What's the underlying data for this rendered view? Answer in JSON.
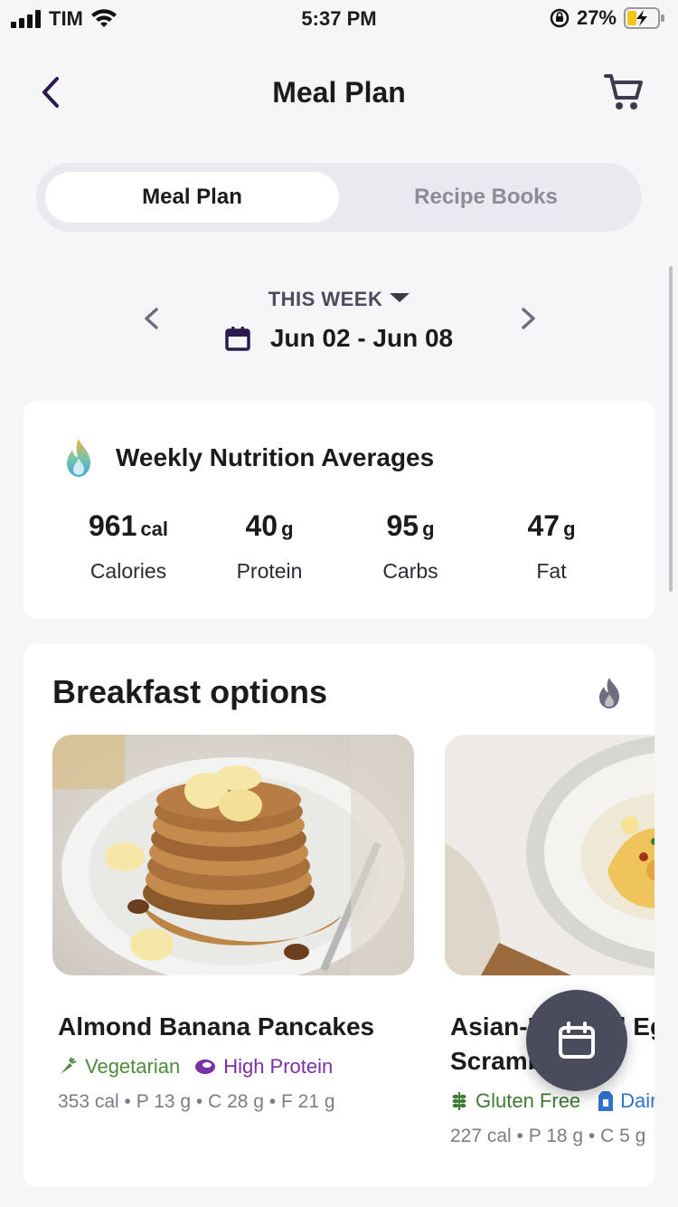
{
  "status_bar": {
    "carrier": "TIM",
    "time": "5:37 PM",
    "battery": "27%"
  },
  "nav": {
    "title": "Meal Plan"
  },
  "segmented": {
    "active": "Meal Plan",
    "inactive": "Recipe Books"
  },
  "week": {
    "label": "THIS WEEK",
    "range": "Jun 02 - Jun 08"
  },
  "nutrition": {
    "title": "Weekly Nutrition Averages",
    "stats": [
      {
        "value": "961",
        "unit": "cal",
        "label": "Calories"
      },
      {
        "value": "40",
        "unit": "g",
        "label": "Protein"
      },
      {
        "value": "95",
        "unit": "g",
        "label": "Carbs"
      },
      {
        "value": "47",
        "unit": "g",
        "label": "Fat"
      }
    ]
  },
  "breakfast": {
    "title": "Breakfast options",
    "recipes": [
      {
        "name": "Almond Banana Pancakes",
        "tags": [
          "Vegetarian",
          "High Protein"
        ],
        "macros": "353 cal • P 13 g • C 28 g • F 21 g"
      },
      {
        "name": "Asian-Inspired Eggs Scramble",
        "tags": [
          "Gluten Free",
          "Dairy Free"
        ],
        "macros": "227 cal • P 18 g • C 5 g"
      }
    ]
  },
  "colors": {
    "accent": "#2b1a4f",
    "fab": "#4a4c5d",
    "vegetarian": "#4f8a3b",
    "high_protein": "#7a2fa8",
    "gluten_free": "#3d7a33",
    "dairy_free": "#2e74c8"
  }
}
